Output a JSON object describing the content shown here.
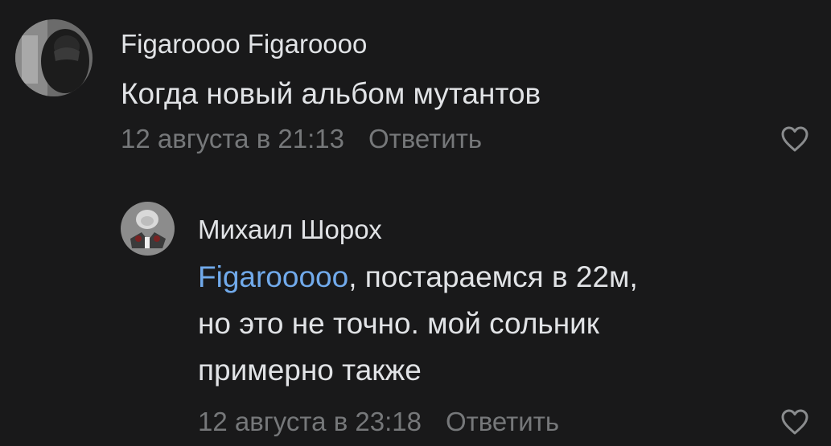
{
  "comments": [
    {
      "author": "Figaroooo Figaroooo",
      "text": "Когда новый альбом мутантов",
      "date": "12 августа в 21:13",
      "reply_label": "Ответить"
    },
    {
      "author": "Михаил Шорох",
      "mention": "Figarooooo",
      "text_rest_1": ", постараемся в 22м,",
      "text_line_2": "но это не точно. мой сольник",
      "text_line_3": "примерно также",
      "date": "12 августа в 23:18",
      "reply_label": "Ответить"
    }
  ],
  "icons": {
    "like": "heart-outline-icon"
  },
  "colors": {
    "background": "#19191a",
    "text": "#e1e3e6",
    "muted": "#76787a",
    "link": "#71aaeb"
  }
}
